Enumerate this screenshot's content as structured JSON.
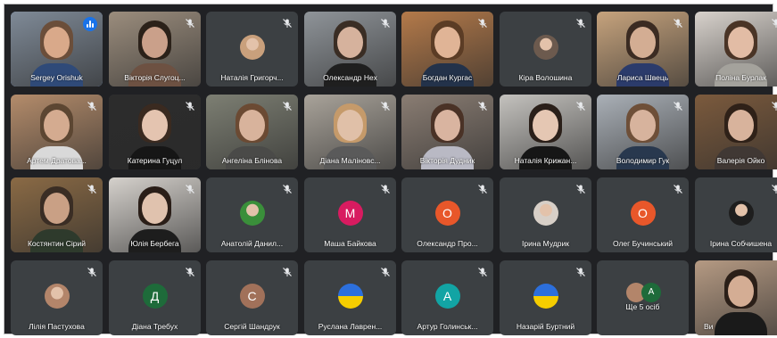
{
  "app": "Google Meet",
  "colors": {
    "background": "#202124",
    "tile": "#3c4043",
    "accent": "#1a73e8",
    "active_outline": "#8ab4f8"
  },
  "mic_icon": "mic-off-icon",
  "rows": [
    [
      {
        "name": "Sergey Orishuk",
        "kind": "video",
        "speaking": true,
        "scene": "#7f8a97",
        "skin": "#d9a98a",
        "hair": "#6b4e3a",
        "shirt": "#2f4a78"
      },
      {
        "name": "Вікторія Слугоц...",
        "kind": "video",
        "muted": true,
        "scene": "#9b8d7d",
        "skin": "#caa08a",
        "hair": "#2b2119",
        "shirt": "#6d5142"
      },
      {
        "name": "Наталія Григорч...",
        "kind": "photo",
        "muted": true,
        "photo_bg": "#c9a07c"
      },
      {
        "name": "Олександр Нех",
        "kind": "video",
        "muted": true,
        "scene": "#8f9499",
        "skin": "#d6b29d",
        "hair": "#3a2d24",
        "shirt": "#1f1f1f"
      },
      {
        "name": "Богдан Кургас",
        "kind": "video",
        "muted": true,
        "scene": "#b47a4a",
        "skin": "#e0b496",
        "hair": "#5b3c25",
        "shirt": "#23324a"
      },
      {
        "name": "Кіра Волошина",
        "kind": "photo",
        "muted": true,
        "photo_bg": "#6c5a4e"
      },
      {
        "name": "Лариса Швець",
        "kind": "video",
        "muted": true,
        "scene": "#c6a37d",
        "skin": "#d3ad93",
        "hair": "#3b2b22",
        "shirt": "#2b3b6b"
      },
      {
        "name": "Поліна Бурлак",
        "kind": "video",
        "muted": true,
        "scene": "#d8d2cc",
        "skin": "#e2bca5",
        "hair": "#4a3426",
        "shirt": "#a4a29c"
      }
    ],
    [
      {
        "name": "Артем Дратова...",
        "kind": "video",
        "muted": true,
        "scene": "#b48c6b",
        "skin": "#d4ab90",
        "hair": "#5c4632",
        "shirt": "#d9d9d9"
      },
      {
        "name": "Катерина Гуцул",
        "kind": "video",
        "muted": true,
        "scene": "#2c2c2c",
        "skin": "#e4c4b0",
        "hair": "#3a2a20",
        "shirt": "#161616"
      },
      {
        "name": "Ангеліна Блінова",
        "kind": "video",
        "muted": true,
        "scene": "#7d7f73",
        "skin": "#d8b39c",
        "hair": "#6b4a33",
        "shirt": "#4a4a48"
      },
      {
        "name": "Діана Маліновс...",
        "kind": "video",
        "muted": true,
        "scene": "#a9a39a",
        "skin": "#e0c0a8",
        "hair": "#c59a6a",
        "shirt": "#5a5a5a"
      },
      {
        "name": "Вікторія Дудник",
        "kind": "video",
        "muted": true,
        "scene": "#8a7d73",
        "skin": "#d9b4a0",
        "hair": "#4a3226",
        "shirt": "#b9b9c4"
      },
      {
        "name": "Наталія Крижан...",
        "kind": "video",
        "muted": true,
        "scene": "#c4c2be",
        "skin": "#e5c7b3",
        "hair": "#2a1f19",
        "shirt": "#161616"
      },
      {
        "name": "Володимир Гук",
        "kind": "video",
        "muted": true,
        "scene": "#aab0b7",
        "skin": "#d7b39d",
        "hair": "#6e4f38",
        "shirt": "#28384e"
      },
      {
        "name": "Валерія Ойко",
        "kind": "video",
        "muted": true,
        "scene": "#7b5a3d",
        "skin": "#d8b39c",
        "hair": "#2f2118",
        "shirt": "#403834"
      }
    ],
    [
      {
        "name": "Костянтин Сірий",
        "kind": "video",
        "muted": true,
        "scene": "#8a6a45",
        "skin": "#c9a085",
        "hair": "#3a2d24",
        "shirt": "#2e3a2c"
      },
      {
        "name": "Юлія Бербега",
        "kind": "video",
        "muted": true,
        "scene": "#d5d1cc",
        "skin": "#e0c2ae",
        "hair": "#2a1e18",
        "shirt": "#1d1d1d"
      },
      {
        "name": "Анатолій Данил...",
        "kind": "photo",
        "muted": true,
        "photo_bg": "#3a8f3a"
      },
      {
        "name": "Маша Байкова",
        "kind": "letter",
        "muted": true,
        "letter": "M",
        "avatar_color": "#d81b60"
      },
      {
        "name": "Олександр Про...",
        "kind": "letter",
        "muted": true,
        "letter": "O",
        "avatar_color": "#e8572a"
      },
      {
        "name": "Ірина Мудрик",
        "kind": "photo",
        "muted": true,
        "photo_bg": "#d7cfc7"
      },
      {
        "name": "Олег Бучинський",
        "kind": "letter",
        "muted": true,
        "letter": "O",
        "avatar_color": "#e8572a"
      },
      {
        "name": "Ірина Собчишена",
        "kind": "photo",
        "muted": true,
        "photo_bg": "#1e1e1e"
      }
    ],
    [
      {
        "name": "Лілія Пастухова",
        "kind": "photo",
        "muted": true,
        "photo_bg": "#b3856a"
      },
      {
        "name": "Діана Требух",
        "kind": "letter",
        "muted": true,
        "letter": "Д",
        "avatar_color": "#1e6b3a"
      },
      {
        "name": "Сергій Шандрук",
        "kind": "letter",
        "muted": true,
        "letter": "С",
        "avatar_color": "#a1715a"
      },
      {
        "name": "Руслана Лаврен...",
        "kind": "flag",
        "muted": true
      },
      {
        "name": "Артур Голинськ...",
        "kind": "letter",
        "muted": true,
        "letter": "А",
        "avatar_color": "#12a4a4"
      },
      {
        "name": "Назарій Буртний",
        "kind": "flag",
        "muted": true
      },
      {
        "name": "Ще 5 осіб",
        "kind": "more",
        "letter": "А",
        "avatar_color": "#1e6b3a"
      },
      {
        "name": "Ви",
        "kind": "video",
        "muted": false,
        "scene": "#b59a83",
        "skin": "#d4ad94",
        "hair": "#2b1f18",
        "shirt": "#1a1a1a"
      }
    ]
  ]
}
